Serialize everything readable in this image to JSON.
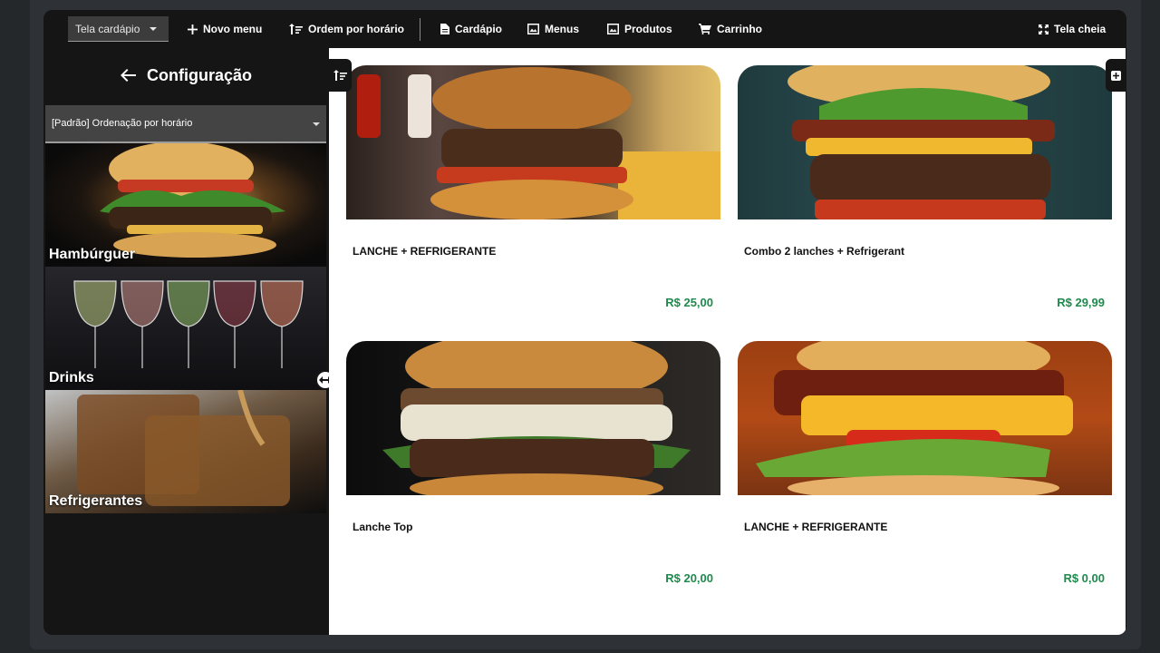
{
  "toolbar": {
    "screen_select": "Tela cardápio",
    "new_menu": "Novo menu",
    "sort_by_time": "Ordem por horário",
    "menu": "Cardápio",
    "menus": "Menus",
    "products": "Produtos",
    "cart": "Carrinho",
    "fullscreen": "Tela cheia"
  },
  "sidebar": {
    "title": "Configuração",
    "order_select": "[Padrão] Ordenação por horário",
    "categories": [
      {
        "label": "Hambúrguer"
      },
      {
        "label": "Drinks"
      },
      {
        "label": "Refrigerantes"
      }
    ]
  },
  "products": [
    {
      "name": "LANCHE + REFRIGERANTE",
      "price": "R$ 25,00"
    },
    {
      "name": "Combo 2 lanches + Refrigerant",
      "price": "R$ 29,99"
    },
    {
      "name": "Lanche Top",
      "price": "R$ 20,00"
    },
    {
      "name": "LANCHE + REFRIGERANTE",
      "price": "R$ 0,00"
    }
  ],
  "colors": {
    "price": "#1e8a4c",
    "background": "#151515",
    "panel": "#ffffff"
  }
}
